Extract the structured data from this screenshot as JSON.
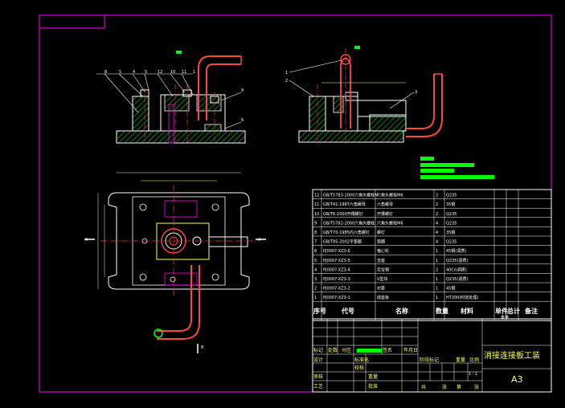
{
  "drawing": {
    "title": "消接连接板工装",
    "sheet_size": "A3",
    "scale": "1 : 1"
  },
  "parts_header": {
    "seq": "序号",
    "code": "代号",
    "name": "名称",
    "qty": "数量",
    "material": "材料",
    "weight_single": "单件",
    "weight_total": "总计",
    "weight_label": "重量",
    "remarks": "备注"
  },
  "parts": [
    {
      "no": "12",
      "code": "GB/T5783-2000六角头螺栓M",
      "name": "六角头螺栓M6",
      "qty": "2",
      "material": "Q235"
    },
    {
      "no": "11",
      "code": "GB/T41-1987六角螺母",
      "name": "六角螺母",
      "qty": "2",
      "material": "35钢"
    },
    {
      "no": "10",
      "code": "GB/T6-2000开槽螺钉",
      "name": "开槽螺钉",
      "qty": "2",
      "material": "Q235"
    },
    {
      "no": "9",
      "code": "GB/T5782-2000六角头螺栓",
      "name": "六角头螺栓M6",
      "qty": "4",
      "material": "Q235"
    },
    {
      "no": "8",
      "code": "GB/T70-1985内六角螺钉",
      "name": "螺钉",
      "qty": "4",
      "material": "35钢"
    },
    {
      "no": "7",
      "code": "GB/T95-2002平垫圈",
      "name": "垫圈",
      "qty": "4",
      "material": "Q235"
    },
    {
      "no": "6",
      "code": "PJ0007-XZ3-6",
      "name": "偏心轮",
      "qty": "1",
      "material": "45钢(调质)"
    },
    {
      "no": "5",
      "code": "PJ0007-XZ3-5",
      "name": "支座",
      "qty": "1",
      "material": "Q235(调质)"
    },
    {
      "no": "4",
      "code": "PJ0007-XZ3-4",
      "name": "定位销",
      "qty": "2",
      "material": "40Cr(调质)"
    },
    {
      "no": "3",
      "code": "PJ0007-XZ3-3",
      "name": "V型块",
      "qty": "1",
      "material": "Q235(调质)"
    },
    {
      "no": "2",
      "code": "PJ0007-XZ3-2",
      "name": "衬套",
      "qty": "1",
      "material": "45钢"
    },
    {
      "no": "1",
      "code": "PJ0007-XZ3-1",
      "name": "底座板",
      "qty": "1",
      "material": "HT200(时效处理)"
    }
  ],
  "title_block": {
    "mark": "标记",
    "count": "处数",
    "zone": "分区",
    "change_doc": "更改文件号",
    "signature": "签名",
    "date": "年月日",
    "design": "设计",
    "standardize": "标准化",
    "review": "审核",
    "process": "工艺",
    "approve": "批准",
    "check": "校核",
    "stage_mark": "阶段标记",
    "weight": "重量",
    "scale_label": "比例",
    "total": "共",
    "sheets": "张",
    "page": "第",
    "sheet": "张"
  },
  "view_labels": {
    "a_left": "A",
    "a_right": "A",
    "b": "B"
  },
  "balloons_front": [
    "8",
    "5",
    "4",
    "5",
    "12",
    "10",
    "11",
    "1",
    "9",
    "6"
  ],
  "balloons_side": [
    "1",
    "2",
    "3"
  ],
  "colors": {
    "frame": "#ff00ff",
    "outline": "#ffffff",
    "hatch": "#00ff00",
    "center": "#ff3333",
    "dim": "#ffff66",
    "hidden": "#00ffff",
    "highlight": "#00ff00"
  }
}
